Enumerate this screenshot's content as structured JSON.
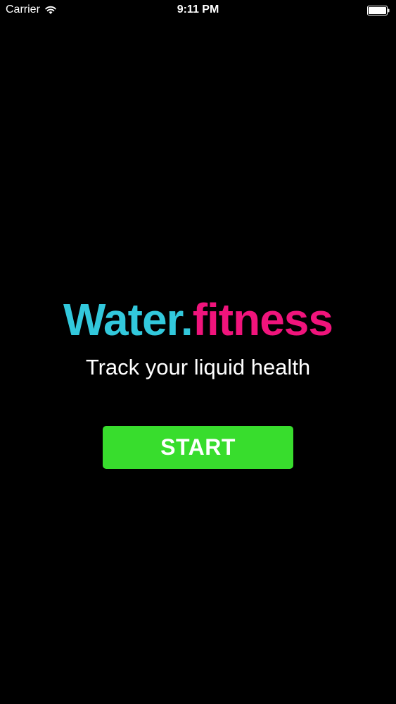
{
  "status_bar": {
    "carrier": "Carrier",
    "time": "9:11 PM",
    "wifi_icon": "wifi-icon",
    "battery_icon": "battery-icon"
  },
  "app": {
    "brand_water": "Water",
    "brand_dot": ".",
    "brand_fitness": "fitness",
    "tagline": "Track your liquid health",
    "start_label": "START"
  },
  "colors": {
    "background": "#000000",
    "brand_water": "#32c8dc",
    "brand_fitness": "#f0147c",
    "start_button": "#38dd2d",
    "text": "#ffffff"
  }
}
